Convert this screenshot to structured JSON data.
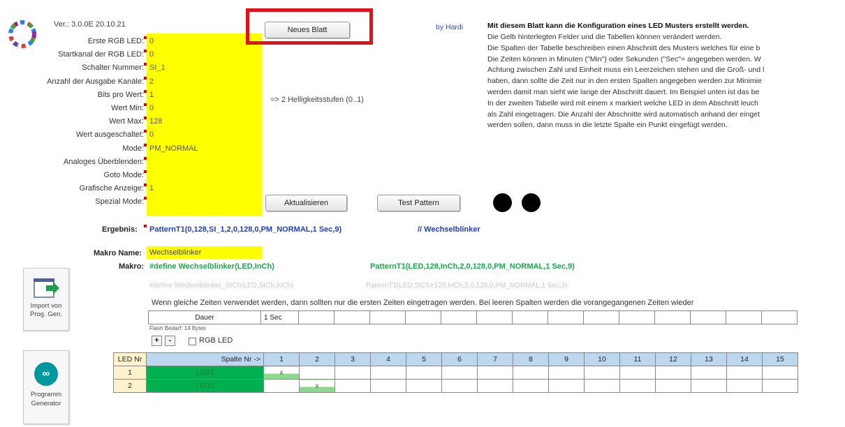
{
  "header": {
    "version": "Ver.: 3.0.0E 20.10.21",
    "new_sheet_button": "Neues Blatt",
    "author": "by Hardi",
    "info_title": "Mit diesem Blatt kann die Konfiguration eines LED Musters erstellt werden.",
    "info_lines": [
      "Die Gelb hinterlegten Felder und die Tabellen können verändert werden.",
      "Die Spalten der Tabelle beschreiben einen Abschnitt des Musters welches für eine b",
      "Die Zeiten können in Minuten (\"Min\") oder Sekunden (\"Sec\"= angegeben werden. W",
      "Achtung zwischen Zahl und Einheit muss ein Leerzeichen stehen und die Groß- und l",
      "haben, dann sollte die Zeit nur in den ersten Spalten angegeben werden zur Minimie",
      "werden damit man sieht wie lange der Abschnitt dauert. Im Beispiel unten ist das be",
      "In der zweiten Tabelle wird mit einem x markiert welche LED in dem Abschnitt leuch",
      "als Zahl eingetragen. Die Anzahl der Abschnitte wird automatisch anhand der einget",
      "werden sollen, dann muss in die letzte Spalte ein Punkt eingefügt werden."
    ]
  },
  "config": [
    {
      "label": "Erste RGB LED:",
      "value": "0"
    },
    {
      "label": "Startkanal der RGB LED:",
      "value": "0"
    },
    {
      "label": "Schalter Nummer:",
      "value": "SI_1"
    },
    {
      "label": "Anzahl der Ausgabe Kanäle:",
      "value": "2"
    },
    {
      "label": "Bits pro Wert:",
      "value": "1"
    },
    {
      "label": "Wert Min:",
      "value": "0"
    },
    {
      "label": "Wert Max:",
      "value": "128"
    },
    {
      "label": "Wert ausgeschaltet:",
      "value": "0"
    },
    {
      "label": "Mode:",
      "value": "PM_NORMAL"
    },
    {
      "label": "Analoges Überblenden:",
      "value": ""
    },
    {
      "label": "Goto Mode:",
      "value": ""
    },
    {
      "label": "Grafische Anzeige:",
      "value": "1"
    },
    {
      "label": "Spezial Mode:",
      "value": ""
    }
  ],
  "brightness_note": "=> 2 Helligkeitsstufen (0..1)",
  "update_button": "Aktualisieren",
  "test_button": "Test Pattern",
  "result": {
    "label": "Ergebnis:",
    "value": "PatternT1(0,128,SI_1,2,0,128,0,PM_NORMAL,1 Sec,9)",
    "comment": "// Wechselblinker"
  },
  "macro": {
    "name_label": "Makro Name:",
    "name_value": "Wechselblinker",
    "macro_label": "Makro:",
    "define": "#define Wechselblinker(LED,InCh)",
    "pattern": "PatternT1(LED,128,InCh,2,0,128,0,PM_NORMAL,1 Sec,9)",
    "define2": "#define Wechselblinker_StCh(LED,StCh,InCh)",
    "pattern2": "PatternT1(LED,StCh+128,InCh,2,0,128,0,PM_NORMAL,1 Sec,9)"
  },
  "time_note": "Wenn gleiche Zeiten verwendet werden, dann sollten nur die ersten Zeiten eingetragen werden. Bei leeren Spalten werden die vorangegangenen Zeiten wieder",
  "duration": {
    "label": "Dauer",
    "first": "1 Sec"
  },
  "flash_note": "Flash Bedarf: 14 Bytes",
  "plus_label": "+",
  "minus_label": "-",
  "rgb_checkbox_label": "RGB LED",
  "led_table": {
    "header_nr": "LED Nr",
    "header_col": "Spalte Nr ->",
    "columns": [
      "1",
      "2",
      "3",
      "4",
      "5",
      "6",
      "7",
      "8",
      "9",
      "10",
      "11",
      "12",
      "13",
      "14",
      "15"
    ],
    "rows": [
      {
        "nr": "1",
        "name": "LED1",
        "marks": [
          "x",
          "",
          "",
          "",
          "",
          "",
          "",
          "",
          "",
          "",
          "",
          "",
          "",
          "",
          ""
        ]
      },
      {
        "nr": "2",
        "name": "LED2",
        "marks": [
          "",
          "x",
          "",
          "",
          "",
          "",
          "",
          "",
          "",
          "",
          "",
          "",
          "",
          "",
          ""
        ]
      }
    ]
  },
  "sidebar": {
    "import_label": "Import von Prog. Gen.",
    "generator_label": "Programm Generator"
  },
  "colors": {
    "yellow": "#ffff00",
    "led_green": "#00b050",
    "result_blue": "#1f3fbf",
    "macro_green": "#19a94a",
    "highlight_red": "#e0131b",
    "header_blue": "#bdd7ee"
  }
}
